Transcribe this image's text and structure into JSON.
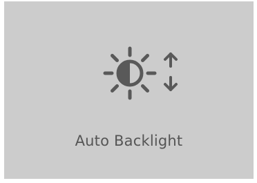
{
  "tile": {
    "label": "Auto Backlight",
    "icon": "auto-brightness-icon"
  },
  "colors": {
    "tile_background": "#cccccc",
    "icon": "#595959",
    "label": "#555555"
  }
}
